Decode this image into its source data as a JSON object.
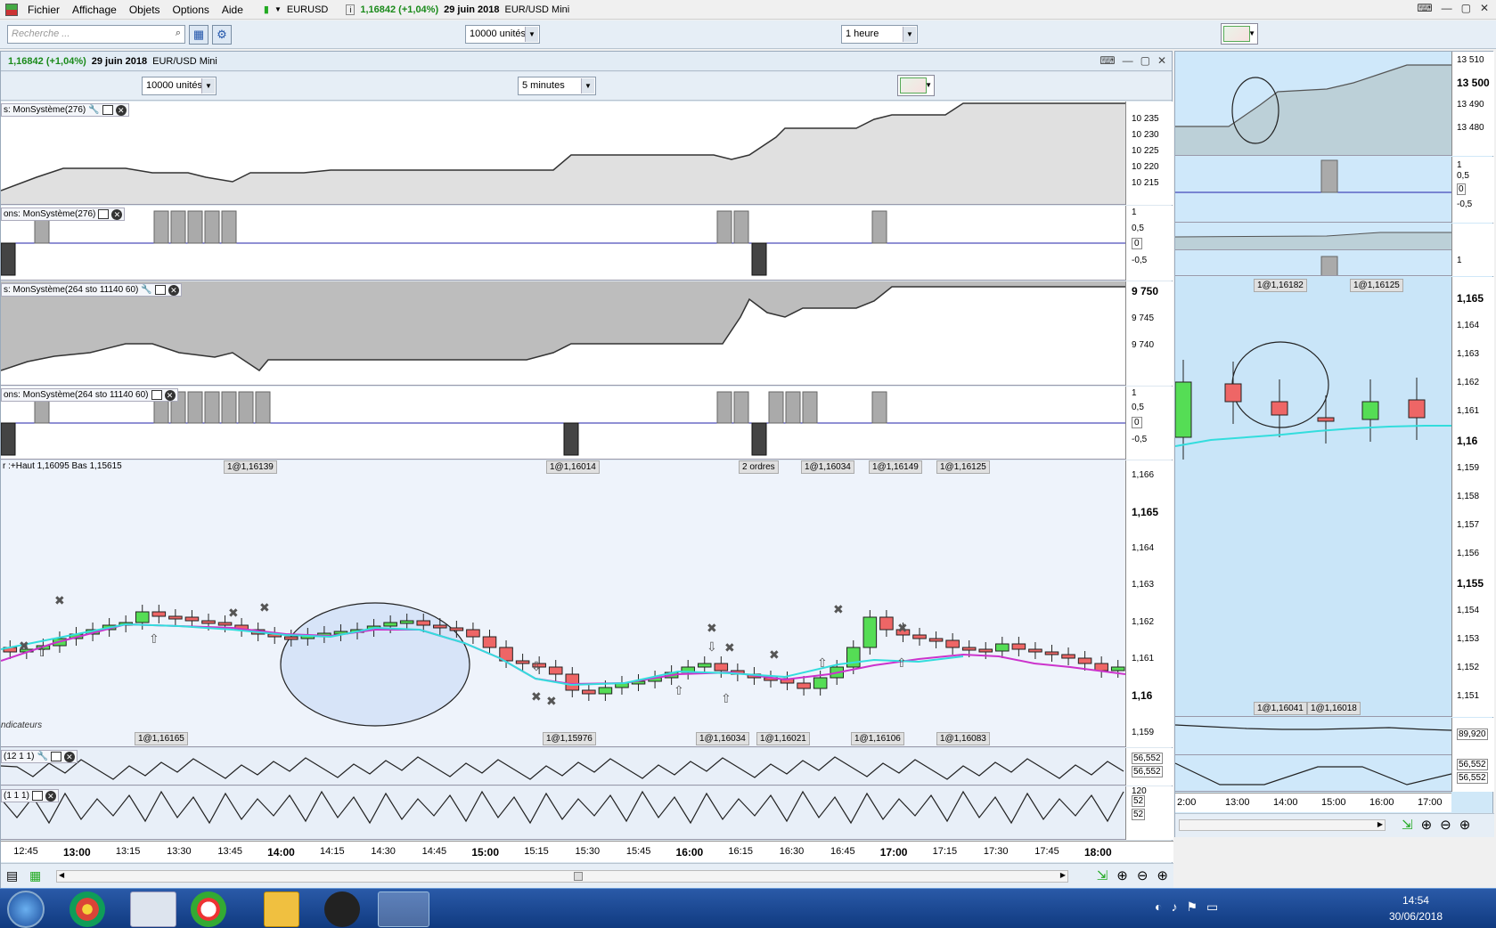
{
  "menu": {
    "items": [
      "Fichier",
      "Affichage",
      "Objets",
      "Options",
      "Aide"
    ],
    "ticker_symbol": "EURUSD",
    "ticker_change": "1,16842 (+1,04%)",
    "ticker_date": "29 juin 2018",
    "ticker_name": "EUR/USD Mini"
  },
  "toolbar": {
    "search_placeholder": "Recherche ...",
    "units": "10000 unités",
    "timeframe": "1 heure"
  },
  "main_window": {
    "price": "1,16842 (+1,04%)",
    "date": "29 juin 2018",
    "name": "EUR/USD Mini",
    "units": "10000 unités",
    "timeframe": "5 minutes"
  },
  "panels": {
    "equity1_title": "s: MonSystème(276)",
    "positions1_title": "ons: MonSystème(276)",
    "equity2_title": "s: MonSystème(264 sto 11140 60)",
    "positions2_title": "ons: MonSystème(264 sto 11140 60)",
    "price_header": "r :+Haut 1,16095  Bas 1,15615",
    "price_footer": "ndicateurs",
    "ind1_title": "(12 1 1)",
    "ind2_title": "(1 1 1)"
  },
  "axes": {
    "equity1": [
      "10 235",
      "10 230",
      "10 225",
      "10 220",
      "10 215"
    ],
    "positions1": [
      "1",
      "0,5",
      "0",
      "-0,5"
    ],
    "equity2": [
      "9 750",
      "9 745",
      "9 740"
    ],
    "positions2": [
      "1",
      "0,5",
      "0",
      "-0,5"
    ],
    "price": [
      "1,166",
      "1,165",
      "1,164",
      "1,163",
      "1,162",
      "1,161",
      "1,16",
      "1,159"
    ],
    "ind1": [
      "56,552",
      "56,552"
    ],
    "ind2": [
      "120",
      "52",
      "52"
    ]
  },
  "order_tags_top": [
    "1@1,16139",
    "1@1,16014",
    "2 ordres",
    "1@1,16034",
    "1@1,16149",
    "1@1,16125"
  ],
  "order_tags_bottom": [
    "1@1,16165",
    "1@1,15976",
    "1@1,16034",
    "1@1,16021",
    "1@1,16106",
    "1@1,16083"
  ],
  "time_labels": [
    "12:45",
    "13:00",
    "13:15",
    "13:30",
    "13:45",
    "14:00",
    "14:15",
    "14:30",
    "14:45",
    "15:00",
    "15:15",
    "15:30",
    "15:45",
    "16:00",
    "16:15",
    "16:30",
    "16:45",
    "17:00",
    "17:15",
    "17:30",
    "17:45",
    "18:00"
  ],
  "right_window": {
    "equity_axis": [
      "13 510",
      "13 500",
      "13 490",
      "13 480"
    ],
    "pos_axis": [
      "1",
      "0,5",
      "0",
      "-0,5"
    ],
    "pos2_axis": [
      "1"
    ],
    "price_axis": [
      "1,165",
      "1,164",
      "1,163",
      "1,162",
      "1,161",
      "1,16",
      "1,159",
      "1,158",
      "1,157",
      "1,156",
      "1,155",
      "1,154",
      "1,153",
      "1,152",
      "1,151"
    ],
    "tags_top": [
      "1@1,16182",
      "1@1,16125"
    ],
    "tags_bottom": [
      "1@1,16041",
      "1@1,16018"
    ],
    "ind_axis": [
      "89,920",
      "56,552",
      "56,552"
    ],
    "time_labels": [
      "2:00",
      "13:00",
      "14:00",
      "15:00",
      "16:00",
      "17:00"
    ]
  },
  "taskbar": {
    "time": "14:54",
    "date": "30/06/2018"
  }
}
